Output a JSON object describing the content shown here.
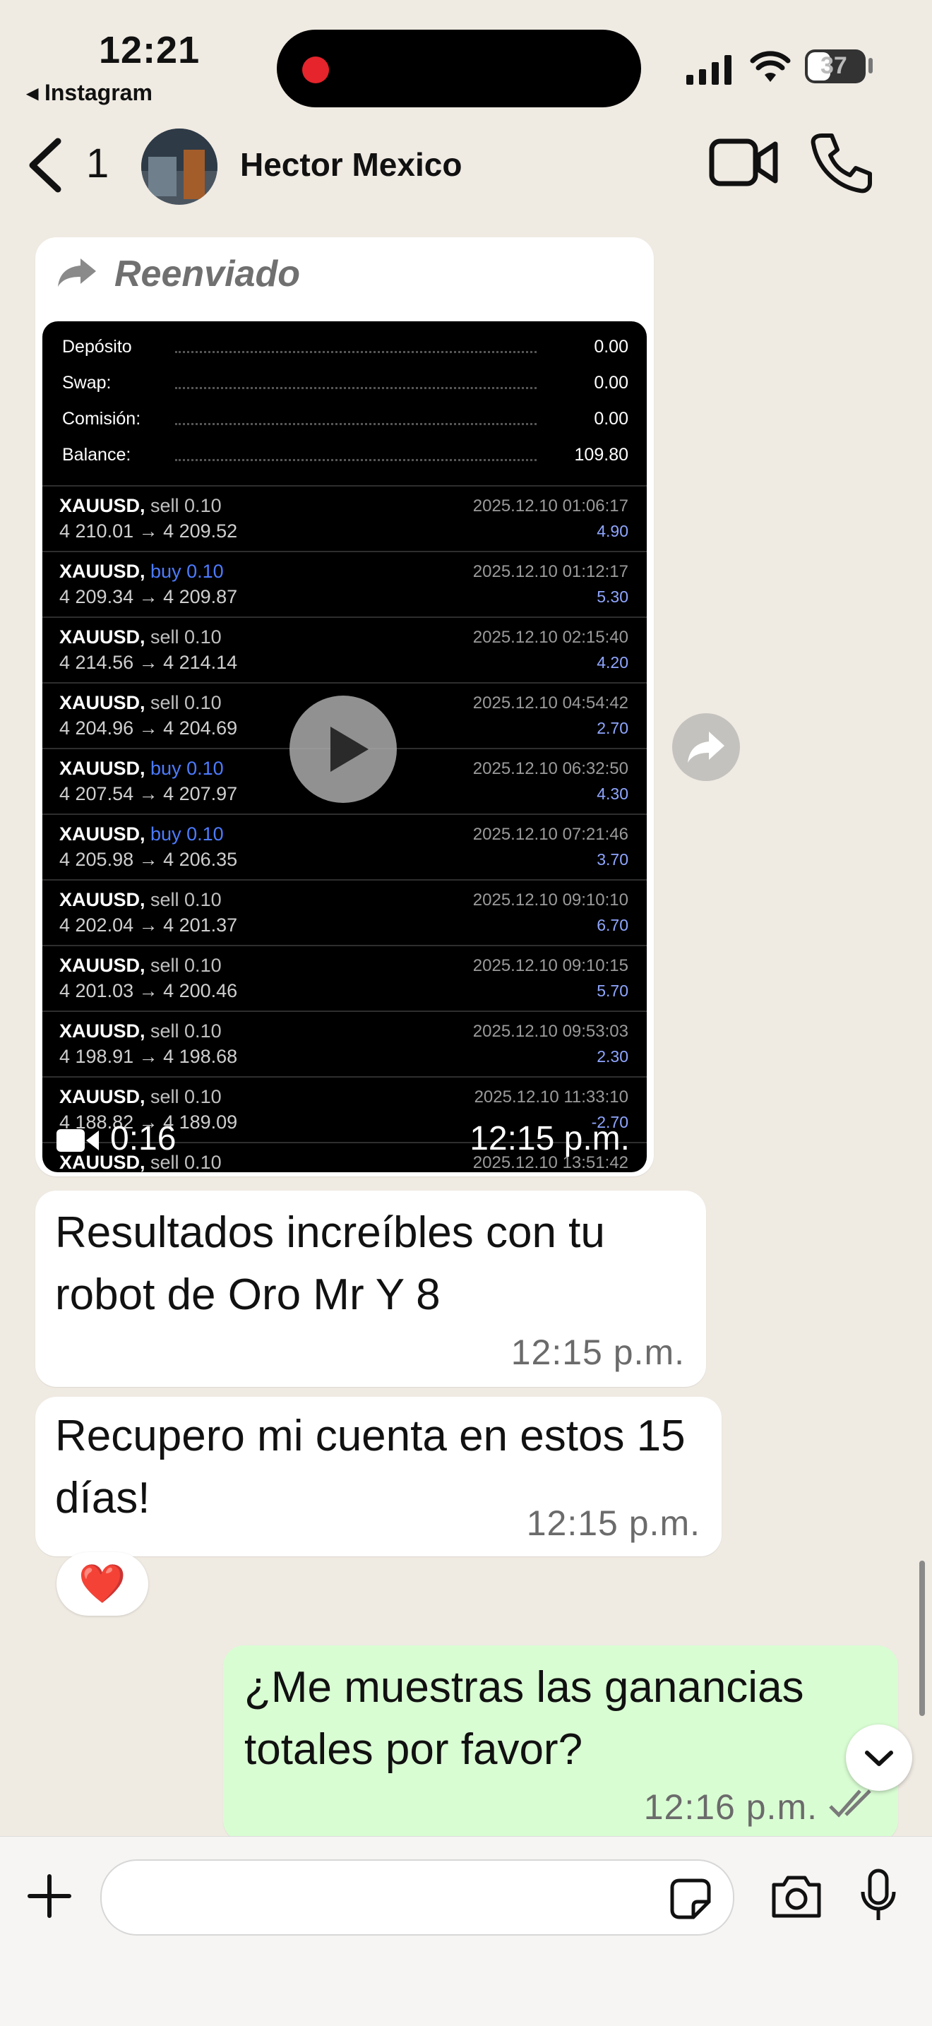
{
  "status_bar": {
    "time": "12:21",
    "back_app": "◂ Instagram",
    "battery": "37"
  },
  "header": {
    "back_count": "1",
    "contact_name": "Hector Mexico"
  },
  "forwarded_label": "Reenviado",
  "video": {
    "summary": [
      {
        "label": "Depósito",
        "value": "0.00"
      },
      {
        "label": "Swap:",
        "value": "0.00"
      },
      {
        "label": "Comisión:",
        "value": "0.00"
      },
      {
        "label": "Balance:",
        "value": "109.80"
      }
    ],
    "trades": [
      {
        "symbol": "XAUUSD,",
        "side": "sell 0.10",
        "prices": "4 210.01 → 4 209.52",
        "date": "2025.12.10 01:06:17",
        "profit": "4.90"
      },
      {
        "symbol": "XAUUSD,",
        "side": "buy 0.10",
        "prices": "4 209.34 → 4 209.87",
        "date": "2025.12.10 01:12:17",
        "profit": "5.30"
      },
      {
        "symbol": "XAUUSD,",
        "side": "sell 0.10",
        "prices": "4 214.56 → 4 214.14",
        "date": "2025.12.10 02:15:40",
        "profit": "4.20"
      },
      {
        "symbol": "XAUUSD,",
        "side": "sell 0.10",
        "prices": "4 204.96 → 4 204.69",
        "date": "2025.12.10 04:54:42",
        "profit": "2.70"
      },
      {
        "symbol": "XAUUSD,",
        "side": "buy 0.10",
        "prices": "4 207.54 → 4 207.97",
        "date": "2025.12.10 06:32:50",
        "profit": "4.30"
      },
      {
        "symbol": "XAUUSD,",
        "side": "buy 0.10",
        "prices": "4 205.98 → 4 206.35",
        "date": "2025.12.10 07:21:46",
        "profit": "3.70"
      },
      {
        "symbol": "XAUUSD,",
        "side": "sell 0.10",
        "prices": "4 202.04 → 4 201.37",
        "date": "2025.12.10 09:10:10",
        "profit": "6.70"
      },
      {
        "symbol": "XAUUSD,",
        "side": "sell 0.10",
        "prices": "4 201.03 → 4 200.46",
        "date": "2025.12.10 09:10:15",
        "profit": "5.70"
      },
      {
        "symbol": "XAUUSD,",
        "side": "sell 0.10",
        "prices": "4 198.91 → 4 198.68",
        "date": "2025.12.10 09:53:03",
        "profit": "2.30"
      },
      {
        "symbol": "XAUUSD,",
        "side": "sell 0.10",
        "prices": "4 188.82 → 4 189.09",
        "date": "2025.12.10 11:33:10",
        "profit": "-2.70"
      },
      {
        "symbol": "XAUUSD,",
        "side": "sell 0.10",
        "prices": "",
        "date": "2025.12.10 13:51:42",
        "profit": ""
      }
    ],
    "duration": "0:16",
    "time": "12:15 p.m."
  },
  "messages": [
    {
      "text": "Resultados increíbles con tu robot de Oro Mr Y 8",
      "time": "12:15 p.m."
    },
    {
      "text": "Recupero mi cuenta en estos 15 días!",
      "time": "12:15 p.m.",
      "reaction": "❤️"
    },
    {
      "text": "¿Me muestras las ganancias totales por favor?",
      "time": "12:16 p.m."
    }
  ],
  "colors": {
    "sell": "#c0c0c0",
    "buy": "#4c7bff",
    "outgoing": "#d9fdd3",
    "background": "#efeae2"
  }
}
